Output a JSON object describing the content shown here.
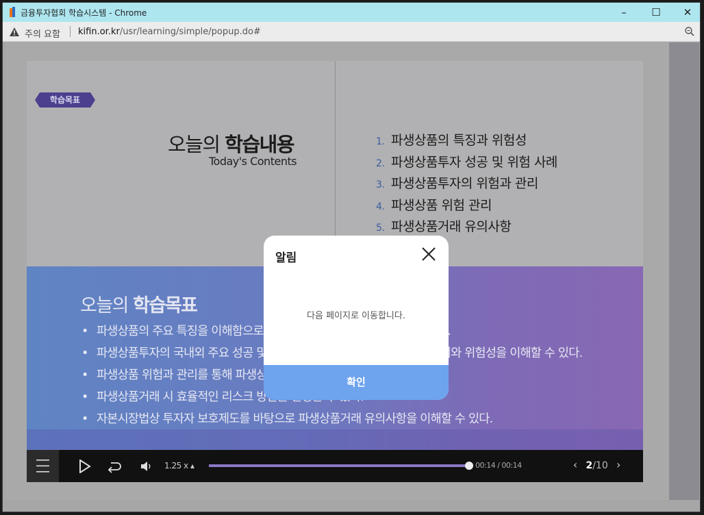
{
  "window": {
    "title": "금융투자협회 학습시스템 - Chrome",
    "minimize": "–",
    "maximize": "☐",
    "close": "✕"
  },
  "addressbar": {
    "security_label": "주의 요함",
    "url_host": "kifin.or.kr",
    "url_path": "/usr/learning/simple/popup.do#"
  },
  "slide": {
    "tag": "학습목표",
    "heading_light": "오늘의 ",
    "heading_bold": "학습내용",
    "subheading": "Today's Contents",
    "contents": [
      {
        "num": "1.",
        "text": "파생상품의 특징과 위험성"
      },
      {
        "num": "2.",
        "text": "파생상품투자 성공 및 위험 사례"
      },
      {
        "num": "3.",
        "text": "파생상품투자의 위험과 관리"
      },
      {
        "num": "4.",
        "text": "파생상품 위험 관리"
      },
      {
        "num": "5.",
        "text": "파생상품거래 유의사항"
      }
    ],
    "objectives_heading_light": "오늘의 ",
    "objectives_heading_bold": "학습목표",
    "objectives": [
      "파생상품의 주요 특징을 이해함으로써 파생상품의 위험성을 설명할 수 있다.",
      "파생상품투자의 국내외 주요 성공 및 실패 사례를 통해 파생상품투자의 기회와 위험성을 이해할 수 있다.",
      "파생상품 위험과 관리를 통해 파생상품거래의 특수성을 설명할 수 있다.",
      "파생상품거래 시 효율적인 리스크 방안을 설명할 수 있다.",
      "자본시장법상 투자자 보호제도를 바탕으로 파생상품거래 유의사항을 이해할 수 있다."
    ]
  },
  "player": {
    "speed": "1.25 x ▴",
    "progress": 1.0,
    "time": "00:14 / 00:14",
    "current_page": "2",
    "total_pages": "/10",
    "prev": "‹",
    "next": "›"
  },
  "dialog": {
    "title": "알림",
    "message": "다음 페이지로 이동합니다.",
    "confirm_label": "확인"
  }
}
